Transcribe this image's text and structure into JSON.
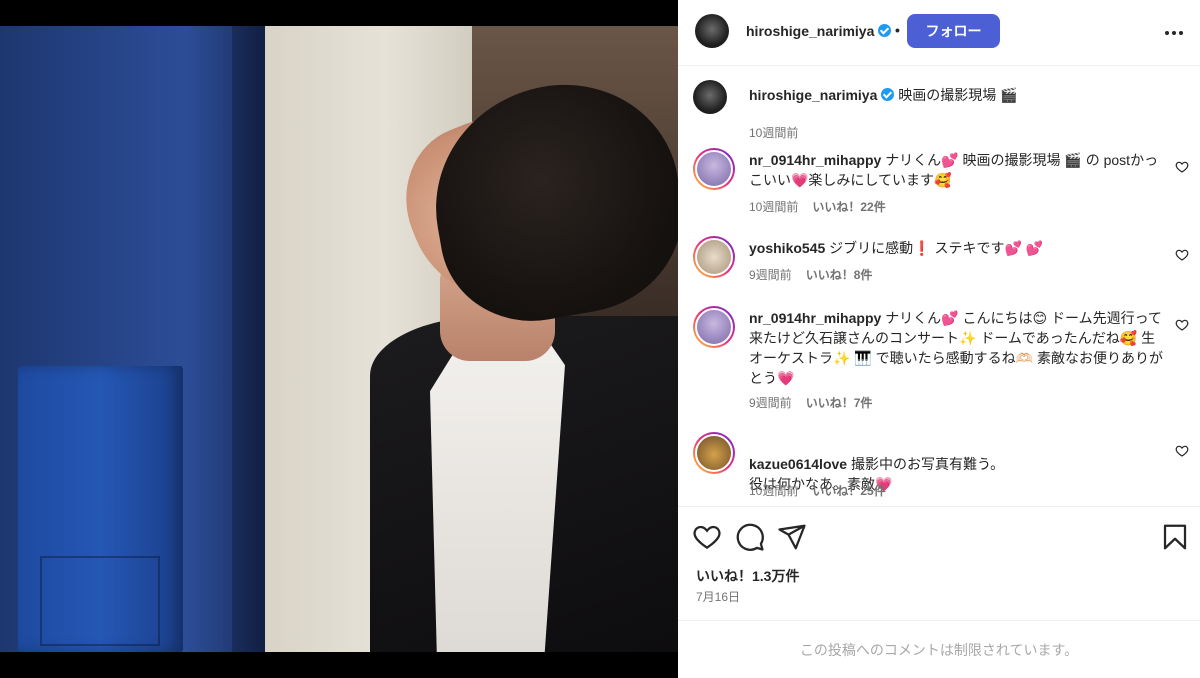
{
  "post": {
    "username": "hiroshige_narimiya",
    "follow_label": "フォロー",
    "dot": "•",
    "caption": "映画の撮影現場",
    "caption_emoji": "🎬",
    "caption_time": "10週間前"
  },
  "comments": [
    {
      "username": "nr_0914hr_mihappy",
      "text": "ナリくん💕 映画の撮影現場 🎬 の postかっこいい💗楽しみにしています🥰",
      "time": "10週間前",
      "likes": "いいね！22件"
    },
    {
      "username": "yoshiko545",
      "text": "ジブリに感動❗ ステキです💕 💕",
      "time": "9週間前",
      "likes": "いいね！8件"
    },
    {
      "username": "nr_0914hr_mihappy",
      "text": "ナリくん💕 こんにちは😊 ドーム先週行って来たけど久石譲さんのコンサート✨ ドームであったんだね🥰 生オーケストラ✨ 🎹 で聴いたら感動するね🫶🏻 素敵なお便りありがとう💗",
      "time": "9週間前",
      "likes": "いいね！7件"
    },
    {
      "username": "kazue0614love",
      "text": "撮影中のお写真有難う。\n役は何かなあ。素敵💗",
      "time": "10週間前",
      "likes": "いいね！25件"
    }
  ],
  "footer": {
    "like_count": "いいね！1.3万件",
    "date": "7月16日",
    "comments_restricted": "この投稿へのコメントは制限されています。"
  },
  "icons": {
    "header_avatar": "profile-avatar-icon",
    "verified": "verified-badge-icon",
    "more": "more-options-icon",
    "like": "heart-icon",
    "comment": "comment-icon",
    "share": "share-icon",
    "save": "bookmark-icon"
  },
  "colors": {
    "follow_button": "#4c5fd5",
    "verified": "#1d9bf0",
    "muted_text": "#737373"
  }
}
